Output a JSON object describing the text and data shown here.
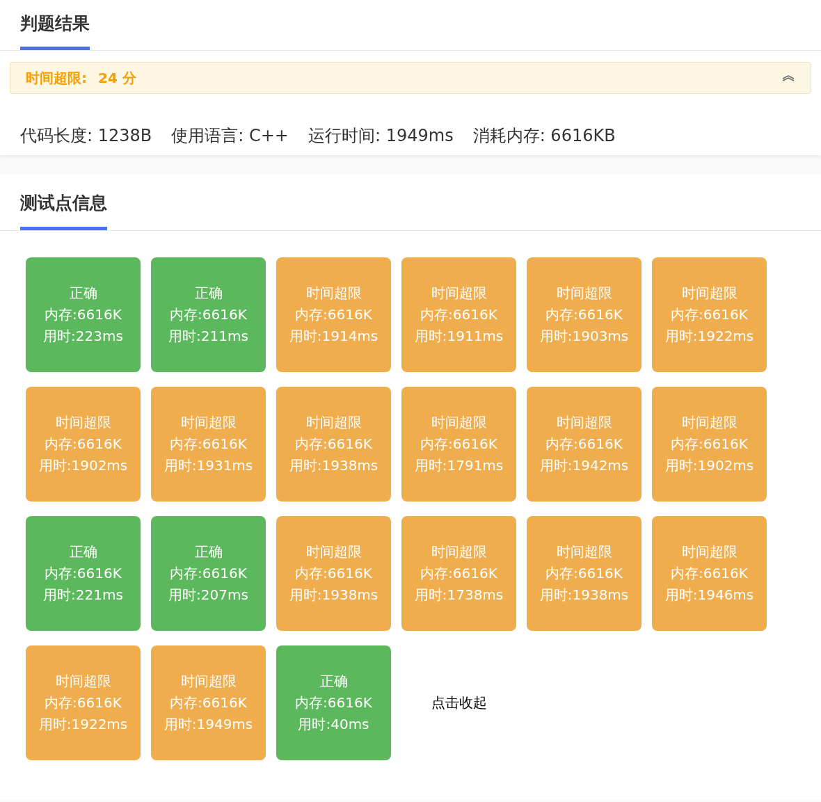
{
  "result_tab": {
    "label": "判题结果",
    "selected": true
  },
  "verdict": {
    "label": "时间超限:",
    "score": "24 分",
    "expanded": true
  },
  "stats": [
    "代码长度: 1238B",
    "使用语言: C++",
    "运行时间: 1949ms",
    "消耗内存: 6616KB"
  ],
  "tests_tab": {
    "label": "测试点信息",
    "selected": true
  },
  "tests": [
    {
      "kind": "ac",
      "status": "正确",
      "memory": "内存:6616K",
      "time": "用时:223ms"
    },
    {
      "kind": "ac",
      "status": "正确",
      "memory": "内存:6616K",
      "time": "用时:211ms"
    },
    {
      "kind": "tle",
      "status": "时间超限",
      "memory": "内存:6616K",
      "time": "用时:1914ms"
    },
    {
      "kind": "tle",
      "status": "时间超限",
      "memory": "内存:6616K",
      "time": "用时:1911ms"
    },
    {
      "kind": "tle",
      "status": "时间超限",
      "memory": "内存:6616K",
      "time": "用时:1903ms"
    },
    {
      "kind": "tle",
      "status": "时间超限",
      "memory": "内存:6616K",
      "time": "用时:1922ms"
    },
    {
      "kind": "tle",
      "status": "时间超限",
      "memory": "内存:6616K",
      "time": "用时:1902ms"
    },
    {
      "kind": "tle",
      "status": "时间超限",
      "memory": "内存:6616K",
      "time": "用时:1931ms"
    },
    {
      "kind": "tle",
      "status": "时间超限",
      "memory": "内存:6616K",
      "time": "用时:1938ms"
    },
    {
      "kind": "tle",
      "status": "时间超限",
      "memory": "内存:6616K",
      "time": "用时:1791ms"
    },
    {
      "kind": "tle",
      "status": "时间超限",
      "memory": "内存:6616K",
      "time": "用时:1942ms"
    },
    {
      "kind": "tle",
      "status": "时间超限",
      "memory": "内存:6616K",
      "time": "用时:1902ms"
    },
    {
      "kind": "ac",
      "status": "正确",
      "memory": "内存:6616K",
      "time": "用时:221ms"
    },
    {
      "kind": "ac",
      "status": "正确",
      "memory": "内存:6616K",
      "time": "用时:207ms"
    },
    {
      "kind": "tle",
      "status": "时间超限",
      "memory": "内存:6616K",
      "time": "用时:1938ms"
    },
    {
      "kind": "tle",
      "status": "时间超限",
      "memory": "内存:6616K",
      "time": "用时:1738ms"
    },
    {
      "kind": "tle",
      "status": "时间超限",
      "memory": "内存:6616K",
      "time": "用时:1938ms"
    },
    {
      "kind": "tle",
      "status": "时间超限",
      "memory": "内存:6616K",
      "time": "用时:1946ms"
    },
    {
      "kind": "tle",
      "status": "时间超限",
      "memory": "内存:6616K",
      "time": "用时:1922ms"
    },
    {
      "kind": "tle",
      "status": "时间超限",
      "memory": "内存:6616K",
      "time": "用时:1949ms"
    },
    {
      "kind": "ac",
      "status": "正确",
      "memory": "内存:6616K",
      "time": "用时:40ms"
    }
  ],
  "collapse_link": "点击收起"
}
